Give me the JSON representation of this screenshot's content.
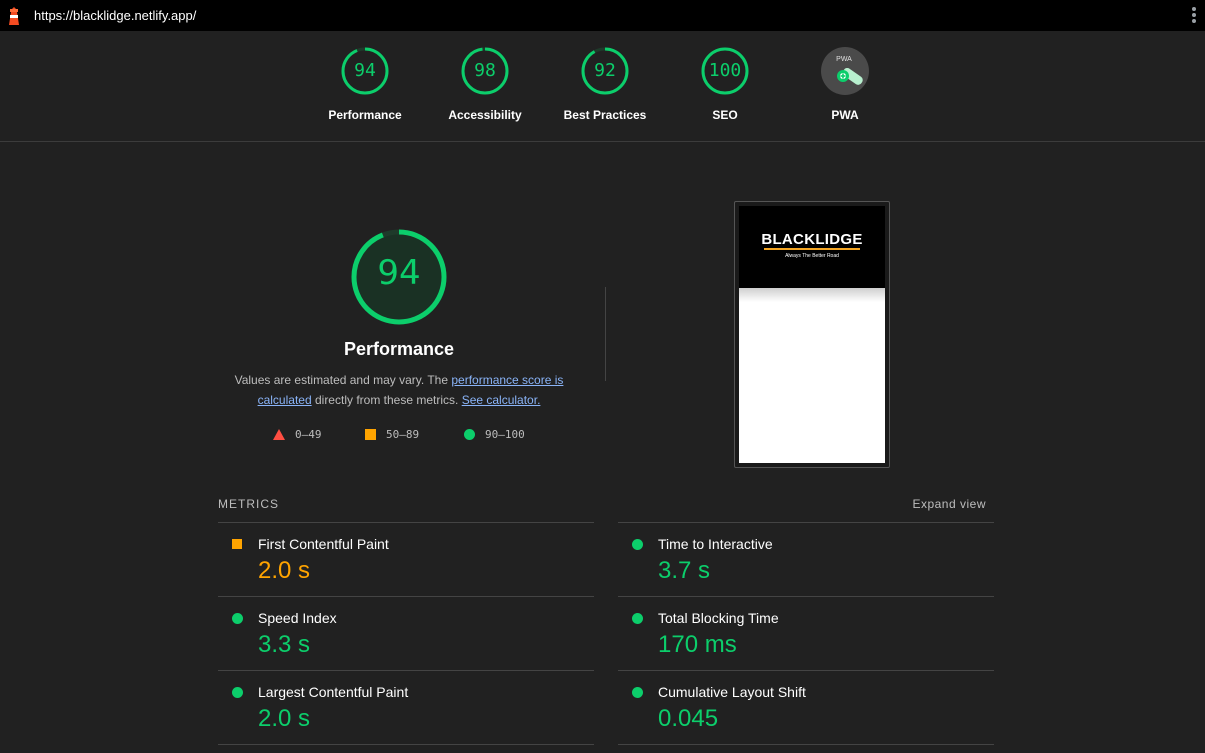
{
  "browser": {
    "url": "https://blacklidge.netlify.app/"
  },
  "summary": {
    "gauges": [
      {
        "label": "Performance",
        "score": "94",
        "fraction": 0.94
      },
      {
        "label": "Accessibility",
        "score": "98",
        "fraction": 0.98
      },
      {
        "label": "Best Practices",
        "score": "92",
        "fraction": 0.92
      },
      {
        "label": "SEO",
        "score": "100",
        "fraction": 1.0
      }
    ],
    "pwa": {
      "label": "PWA",
      "badge_text": "PWA"
    }
  },
  "performance": {
    "score": "94",
    "fraction": 0.94,
    "title": "Performance",
    "desc_prefix": "Values are estimated and may vary. The ",
    "desc_link1": "performance score is calculated",
    "desc_middle": " directly from these metrics. ",
    "desc_link2": "See calculator.",
    "legend": {
      "fail": "0–49",
      "average": "50–89",
      "pass": "90–100"
    }
  },
  "screenshot": {
    "brand": "BLACKLIDGE",
    "tagline": "Always The Better Road"
  },
  "metrics": {
    "header": "METRICS",
    "expand_label": "Expand view",
    "left": [
      {
        "title": "First Contentful Paint",
        "value": "2.0 s",
        "rating": "average"
      },
      {
        "title": "Speed Index",
        "value": "3.3 s",
        "rating": "pass"
      },
      {
        "title": "Largest Contentful Paint",
        "value": "2.0 s",
        "rating": "pass"
      }
    ],
    "right": [
      {
        "title": "Time to Interactive",
        "value": "3.7 s",
        "rating": "pass"
      },
      {
        "title": "Total Blocking Time",
        "value": "170 ms",
        "rating": "pass"
      },
      {
        "title": "Cumulative Layout Shift",
        "value": "0.045",
        "rating": "pass"
      }
    ]
  },
  "colors": {
    "pass": "#0cce6b",
    "average": "#ffa400",
    "fail": "#ff4e42",
    "background": "#212121"
  }
}
